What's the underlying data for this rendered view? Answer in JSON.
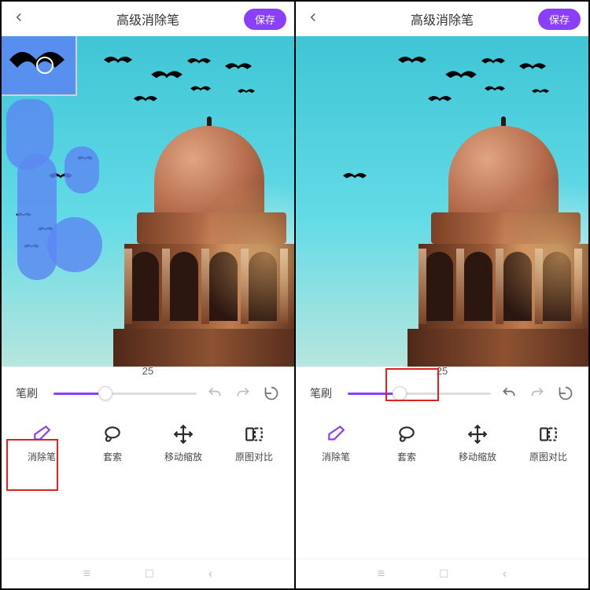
{
  "panes": [
    {
      "title": "高级消除笔",
      "save_label": "保存",
      "brush": {
        "label": "笔刷",
        "value": "25",
        "percent": 36
      },
      "history": {
        "undo_enabled": false,
        "redo_enabled": false,
        "reset_enabled": true
      },
      "tools": [
        {
          "id": "eraser",
          "label": "消除笔",
          "selected": true
        },
        {
          "id": "lasso",
          "label": "套索",
          "selected": false
        },
        {
          "id": "move",
          "label": "移动缩放",
          "selected": false
        },
        {
          "id": "compare",
          "label": "原图对比",
          "selected": false
        }
      ],
      "highlight": {
        "target": "tool-eraser"
      },
      "show_paint_marks": true
    },
    {
      "title": "高级消除笔",
      "save_label": "保存",
      "brush": {
        "label": "笔刷",
        "value": "25",
        "percent": 36
      },
      "history": {
        "undo_enabled": true,
        "redo_enabled": false,
        "reset_enabled": true
      },
      "tools": [
        {
          "id": "eraser",
          "label": "消除笔",
          "selected": true
        },
        {
          "id": "lasso",
          "label": "套索",
          "selected": false
        },
        {
          "id": "move",
          "label": "移动缩放",
          "selected": false
        },
        {
          "id": "compare",
          "label": "原图对比",
          "selected": false
        }
      ],
      "highlight": {
        "target": "slider-knob"
      },
      "show_paint_marks": false
    }
  ]
}
